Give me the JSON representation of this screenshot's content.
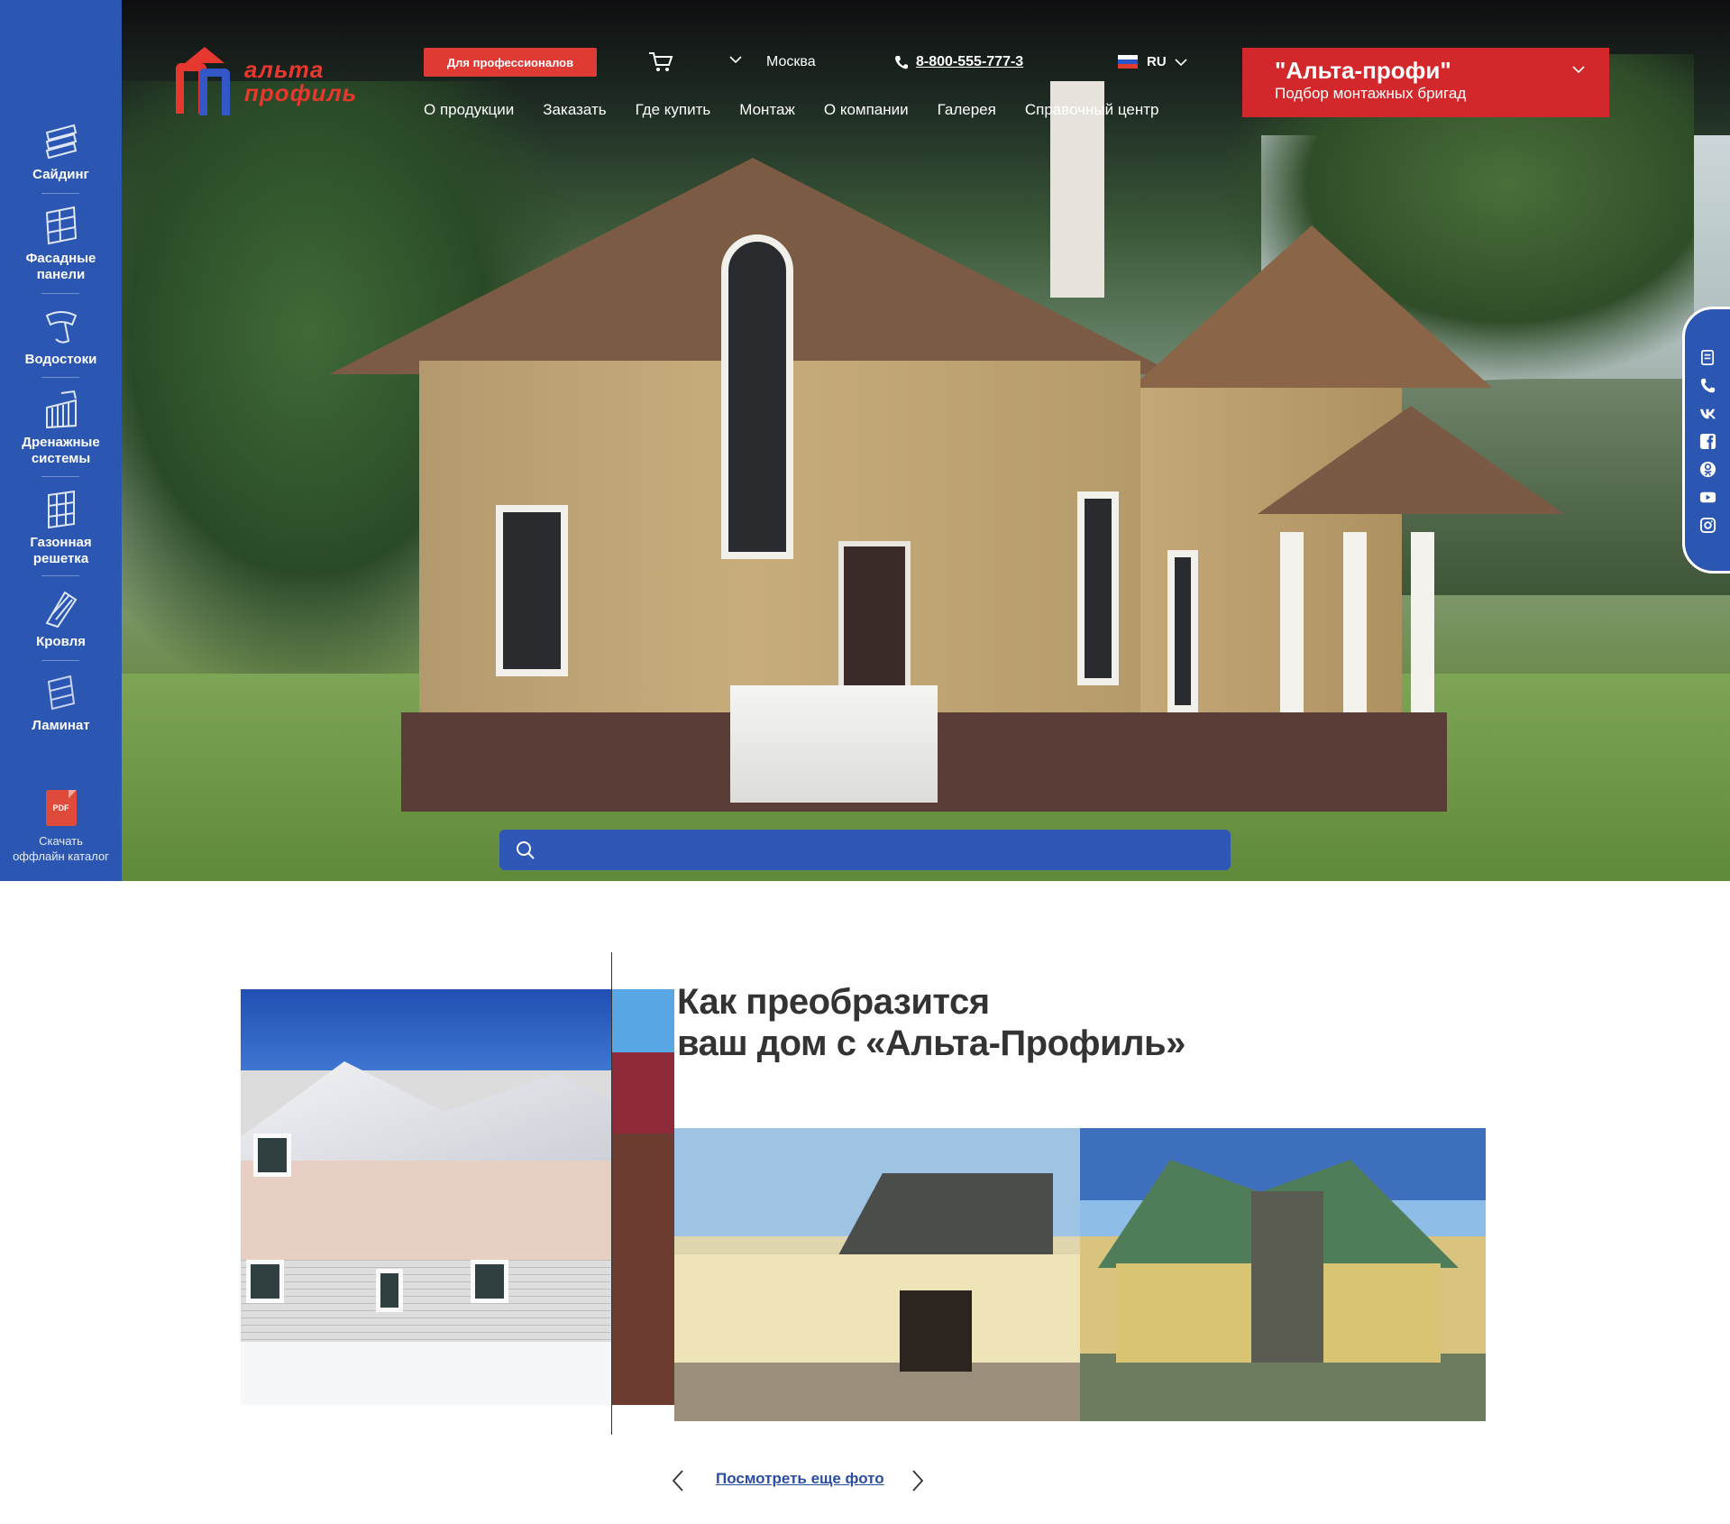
{
  "sidebar": {
    "items": [
      {
        "label": "Сайдинг",
        "icon": "siding-icon"
      },
      {
        "label": "Фасадные\nпанели",
        "icon": "facade-panels-icon"
      },
      {
        "label": "Водостоки",
        "icon": "gutter-icon"
      },
      {
        "label": "Дренажные\nсистемы",
        "icon": "drainage-icon"
      },
      {
        "label": "Газонная\nрешетка",
        "icon": "lawn-grid-icon"
      },
      {
        "label": "Кровля",
        "icon": "roofing-icon"
      },
      {
        "label": "Ламинат",
        "icon": "laminate-icon"
      }
    ],
    "catalog": {
      "icon_text": "PDF",
      "label": "Скачать\nоффлайн каталог"
    }
  },
  "header": {
    "logo_line1": "альта",
    "logo_line2": "профиль",
    "pro_button": "Для профессионалов",
    "city": "Москва",
    "phone": "8-800-555-777-3",
    "lang": "RU",
    "nav": [
      "О продукции",
      "Заказать",
      "Где купить",
      "Монтаж",
      "О компании",
      "Галерея",
      "Справочный центр"
    ],
    "brigade_title": "\"Альта-профи\"",
    "brigade_subtitle": "Подбор монтажных бригад"
  },
  "search": {
    "placeholder": "",
    "value": ""
  },
  "social": [
    "feedback-icon",
    "phone-icon",
    "vk-icon",
    "facebook-icon",
    "odnoklassniki-icon",
    "youtube-icon",
    "instagram-icon"
  ],
  "section": {
    "title_line1": "Как преобразится",
    "title_line2": "ваш дом с «Альта-Профиль»",
    "more_link": "Посмотреть еще фото"
  },
  "colors": {
    "brand_blue": "#2b57b3",
    "brand_red": "#e03a34",
    "brigade_red": "#d3282b",
    "link_blue": "#2b4ea5"
  }
}
